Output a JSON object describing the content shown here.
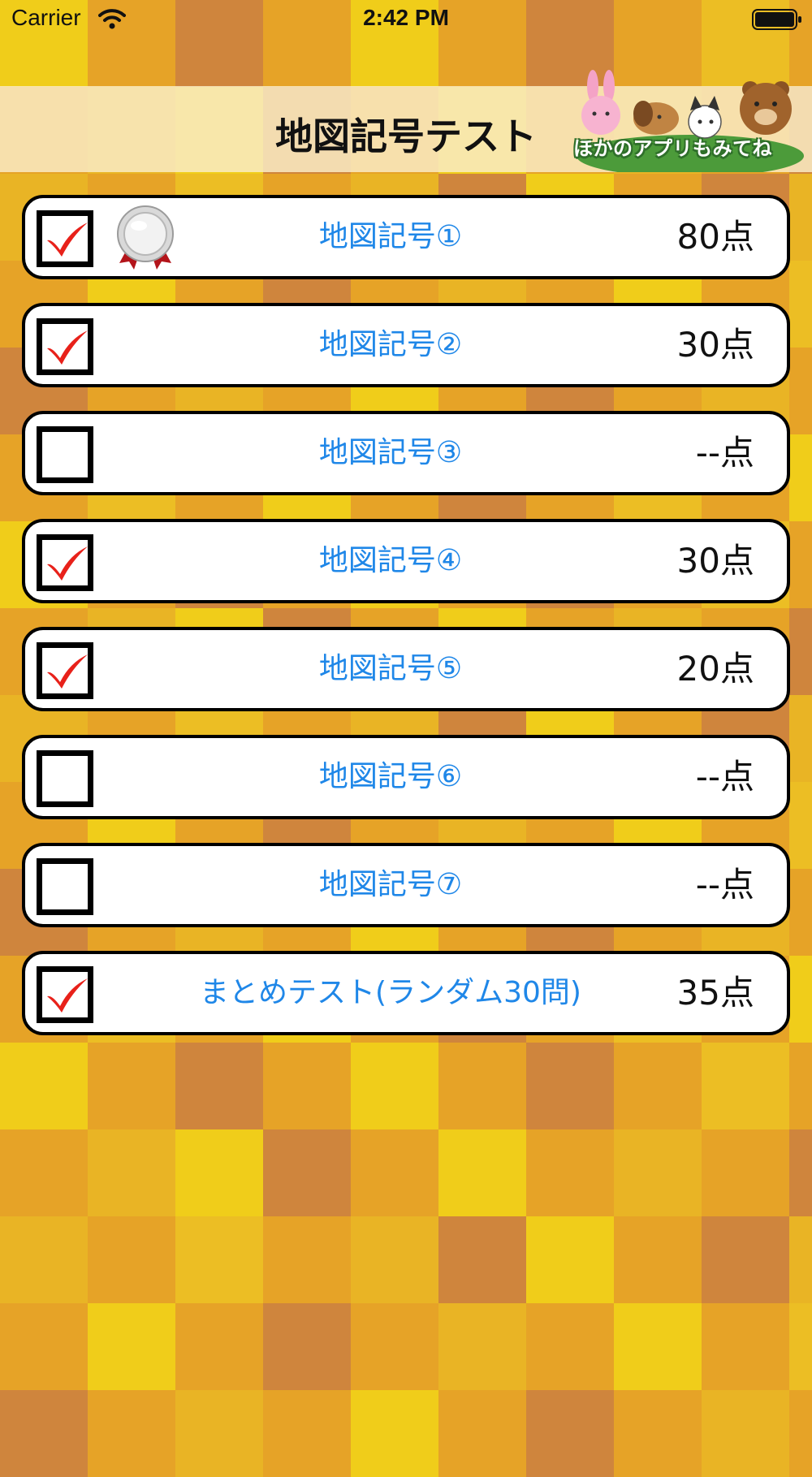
{
  "status_bar": {
    "carrier": "Carrier",
    "time": "2:42 PM"
  },
  "header": {
    "title": "地図記号テスト",
    "promo_label": "ほかのアプリもみてね"
  },
  "tests": [
    {
      "label": "地図記号①",
      "score": "80点",
      "checked": true,
      "medal": "silver-medal-icon"
    },
    {
      "label": "地図記号②",
      "score": "30点",
      "checked": true
    },
    {
      "label": "地図記号③",
      "score": "--点",
      "checked": false
    },
    {
      "label": "地図記号④",
      "score": "30点",
      "checked": true
    },
    {
      "label": "地図記号⑤",
      "score": "20点",
      "checked": true
    },
    {
      "label": "地図記号⑥",
      "score": "--点",
      "checked": false
    },
    {
      "label": "地図記号⑦",
      "score": "--点",
      "checked": false
    },
    {
      "label": "まとめテスト(ランダム30問)",
      "score": "35点",
      "checked": true
    }
  ],
  "colors": {
    "label_blue": "#1f87e8",
    "check_red": "#e8211a",
    "background_tiles": [
      "#e6a327",
      "#f0cd1a",
      "#cf853d",
      "#ecbe24",
      "#e9b425"
    ]
  }
}
